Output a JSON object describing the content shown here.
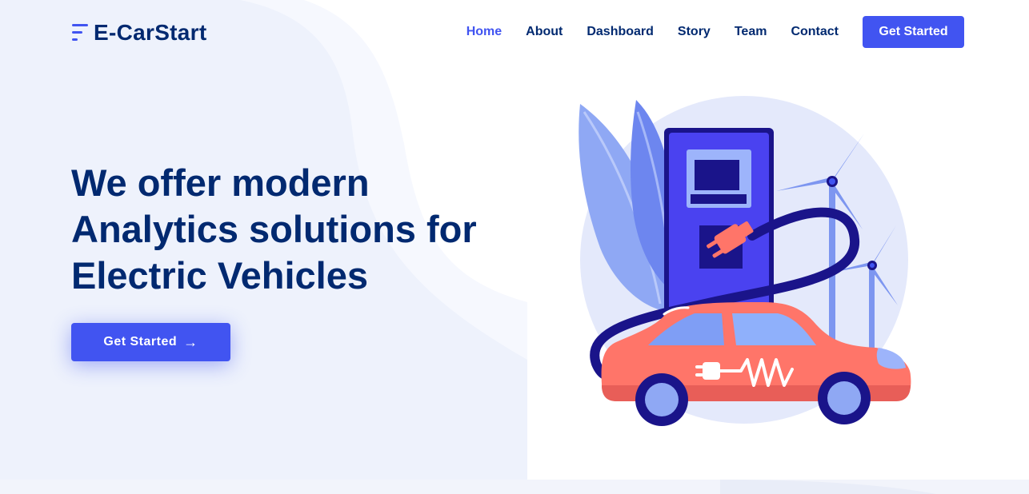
{
  "brand": {
    "name": "E-CarStart",
    "colors": {
      "accent": "#4154f1",
      "navy": "#012970",
      "car": "#ff7569",
      "station": "#4a42f0",
      "cable": "#1a148a"
    }
  },
  "nav": {
    "items": [
      {
        "label": "Home",
        "active": true
      },
      {
        "label": "About",
        "active": false
      },
      {
        "label": "Dashboard",
        "active": false
      },
      {
        "label": "Story",
        "active": false
      },
      {
        "label": "Team",
        "active": false
      },
      {
        "label": "Contact",
        "active": false
      }
    ],
    "cta_label": "Get Started"
  },
  "hero": {
    "title_lines": [
      "We offer modern",
      "Analytics solutions for",
      "Electric Vehicles"
    ],
    "button_label": "Get Started",
    "button_icon": "arrow-right-icon",
    "arrow_glyph": "→"
  },
  "illustration": {
    "icons": [
      "leaf-icon",
      "charging-station-icon",
      "plug-icon",
      "wind-turbine-icon",
      "electric-car-icon"
    ]
  }
}
